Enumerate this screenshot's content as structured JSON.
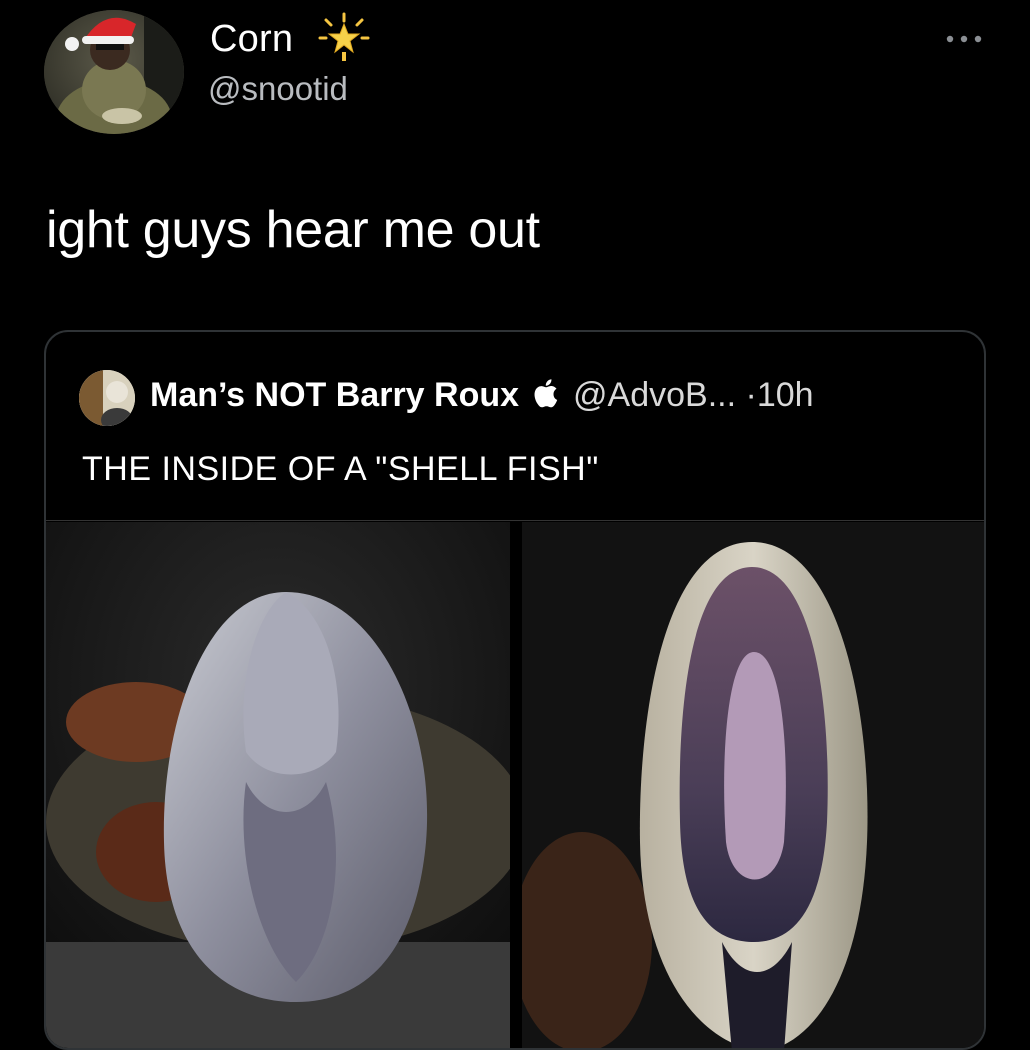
{
  "author": {
    "display_name": "Corn",
    "handle": "@snootid",
    "badge_icon": "star-badge-icon",
    "avatar_icon": "avatar-man-santa-hat"
  },
  "more_menu_icon": "more-dots-icon",
  "tweet_text": "ight guys hear me out",
  "quoted_tweet": {
    "display_name": "Man’s NOT Barry Roux",
    "badge_icon": "apple-logo-icon",
    "handle": "@AdvoB...",
    "separator": "·",
    "time": "10h",
    "text": "THE INSIDE  OF A \"SHELL FISH\"",
    "media": [
      {
        "icon": "photo-shellfish-closed"
      },
      {
        "icon": "photo-shellfish-open"
      }
    ]
  },
  "colors": {
    "background": "#000000",
    "secondary_text": "#b9bcc0",
    "card_border": "#2f3336"
  }
}
